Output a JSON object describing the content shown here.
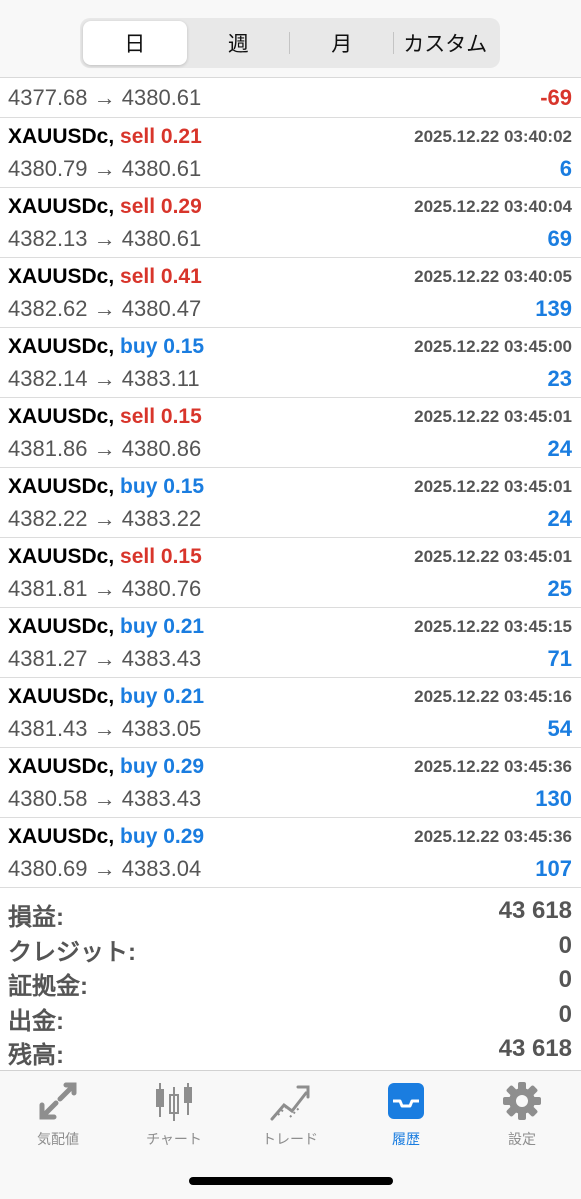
{
  "period_tabs": [
    "日",
    "週",
    "月",
    "カスタム"
  ],
  "active_period": "日",
  "partial_row": {
    "prices": "4377.68 → 4380.61",
    "profit": "-69",
    "profit_sign": "neg"
  },
  "deals": [
    {
      "symbol": "XAUUSDc,",
      "side": "sell",
      "volume": "0.21",
      "time": "2025.12.22 03:40:02",
      "prices": "4380.79 → 4380.61",
      "profit": "6"
    },
    {
      "symbol": "XAUUSDc,",
      "side": "sell",
      "volume": "0.29",
      "time": "2025.12.22 03:40:04",
      "prices": "4382.13 → 4380.61",
      "profit": "69"
    },
    {
      "symbol": "XAUUSDc,",
      "side": "sell",
      "volume": "0.41",
      "time": "2025.12.22 03:40:05",
      "prices": "4382.62 → 4380.47",
      "profit": "139"
    },
    {
      "symbol": "XAUUSDc,",
      "side": "buy",
      "volume": "0.15",
      "time": "2025.12.22 03:45:00",
      "prices": "4382.14 → 4383.11",
      "profit": "23"
    },
    {
      "symbol": "XAUUSDc,",
      "side": "sell",
      "volume": "0.15",
      "time": "2025.12.22 03:45:01",
      "prices": "4381.86 → 4380.86",
      "profit": "24"
    },
    {
      "symbol": "XAUUSDc,",
      "side": "buy",
      "volume": "0.15",
      "time": "2025.12.22 03:45:01",
      "prices": "4382.22 → 4383.22",
      "profit": "24"
    },
    {
      "symbol": "XAUUSDc,",
      "side": "sell",
      "volume": "0.15",
      "time": "2025.12.22 03:45:01",
      "prices": "4381.81 → 4380.76",
      "profit": "25"
    },
    {
      "symbol": "XAUUSDc,",
      "side": "buy",
      "volume": "0.21",
      "time": "2025.12.22 03:45:15",
      "prices": "4381.27 → 4383.43",
      "profit": "71"
    },
    {
      "symbol": "XAUUSDc,",
      "side": "buy",
      "volume": "0.21",
      "time": "2025.12.22 03:45:16",
      "prices": "4381.43 → 4383.05",
      "profit": "54"
    },
    {
      "symbol": "XAUUSDc,",
      "side": "buy",
      "volume": "0.29",
      "time": "2025.12.22 03:45:36",
      "prices": "4380.58 → 4383.43",
      "profit": "130"
    },
    {
      "symbol": "XAUUSDc,",
      "side": "buy",
      "volume": "0.29",
      "time": "2025.12.22 03:45:36",
      "prices": "4380.69 → 4383.04",
      "profit": "107"
    }
  ],
  "summary": [
    {
      "label": "損益:",
      "value": "43 618"
    },
    {
      "label": "クレジット:",
      "value": "0"
    },
    {
      "label": "証拠金:",
      "value": "0"
    },
    {
      "label": "出金:",
      "value": "0"
    },
    {
      "label": "残高:",
      "value": "43 618"
    }
  ],
  "bottom_tabs": [
    {
      "label": "気配値",
      "icon": "quotes-arrows-icon"
    },
    {
      "label": "チャート",
      "icon": "candlestick-chart-icon"
    },
    {
      "label": "トレード",
      "icon": "trade-trend-icon"
    },
    {
      "label": "履歴",
      "icon": "history-inbox-icon"
    },
    {
      "label": "設定",
      "icon": "gear-icon"
    }
  ],
  "active_bottom_tab": "履歴",
  "colors": {
    "sell": "#d8352b",
    "buy": "#1a7de0",
    "profit_positive": "#1a7de0",
    "profit_negative": "#d8352b",
    "active_tab": "#1a7de0",
    "inactive_tab": "#8e8e8e"
  }
}
